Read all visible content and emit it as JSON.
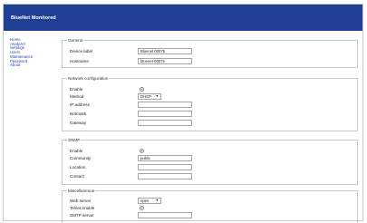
{
  "header": {
    "title": "BlueNet Monitored"
  },
  "sidebar": {
    "items": [
      "Home",
      "Analyzer",
      "Settings",
      "Users",
      "Maintenance",
      "Password",
      "About"
    ]
  },
  "general": {
    "legend": "General",
    "device_label": {
      "label": "Device label",
      "value": "Bluenet 00075"
    },
    "hostname": {
      "label": "Hostname",
      "value": "bluenet-00075"
    }
  },
  "network": {
    "legend": "Network configuration",
    "enable": {
      "label": "Enable",
      "checked": true
    },
    "method": {
      "label": "Method",
      "value": "DHCP"
    },
    "ip_address": {
      "label": "IP address",
      "value": ""
    },
    "netmask": {
      "label": "Netmask",
      "value": ""
    },
    "gateway": {
      "label": "Gateway",
      "value": ""
    }
  },
  "snmp": {
    "legend": "SNMP",
    "enable": {
      "label": "Enable",
      "checked": true
    },
    "community": {
      "label": "Community",
      "value": "public"
    },
    "location": {
      "label": "Location",
      "value": ""
    },
    "contact": {
      "label": "Contact",
      "value": ""
    }
  },
  "misc": {
    "legend": "Miscellaneous",
    "web_server": {
      "label": "Web server",
      "value": "open"
    },
    "telnet": {
      "label": "Telnet enable",
      "checked": true
    },
    "smtp": {
      "label": "SMTP server",
      "value": ""
    }
  },
  "colors": {
    "banner": "#1f3f95",
    "link": "#2a3fa8"
  }
}
